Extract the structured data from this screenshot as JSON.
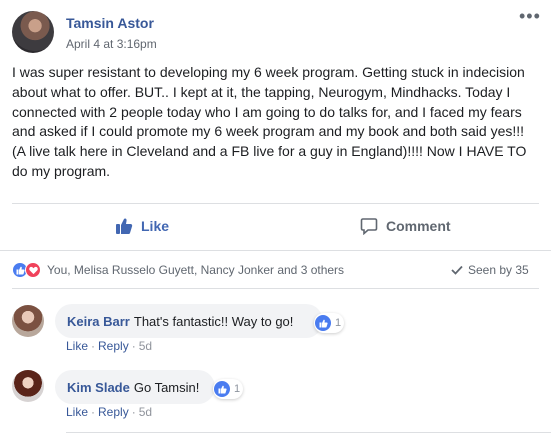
{
  "post": {
    "author": "Tamsin Astor",
    "time": "April 4 at 3:16pm",
    "body": "I was super resistant to developing my 6 week program. Getting stuck in indecision about what to offer. BUT.. I kept at it, the tapping, Neurogym, Mindhacks. Today I connected with 2 people today who I am going to do talks for, and I faced my fears and asked if I could promote my 6 week program and my book and both said yes!!! (A live talk here in Cleveland and a FB live for a guy in England)!!!! Now I HAVE TO do my program.",
    "more_icon": "more-horizontal-icon"
  },
  "actions": {
    "like_label": "Like",
    "comment_label": "Comment"
  },
  "reactions": {
    "reactors_text": "You, Melisa Russelo Guyett, Nancy Jonker and 3 others",
    "seen_by": "Seen by 35"
  },
  "comments": [
    {
      "name": "Keira Barr",
      "text": "That's fantastic!! Way to go!",
      "like_count": "1",
      "like": "Like",
      "reply": "Reply",
      "age": "5d"
    },
    {
      "name": "Kim Slade",
      "text": "Go Tamsin!",
      "like_count": "1",
      "like": "Like",
      "reply": "Reply",
      "age": "5d"
    }
  ],
  "colors": {
    "link_blue": "#385898",
    "like_blue": "#4267b2",
    "love_red": "#f0425b",
    "divider": "#dddfe2",
    "bubble": "#f2f3f5"
  }
}
